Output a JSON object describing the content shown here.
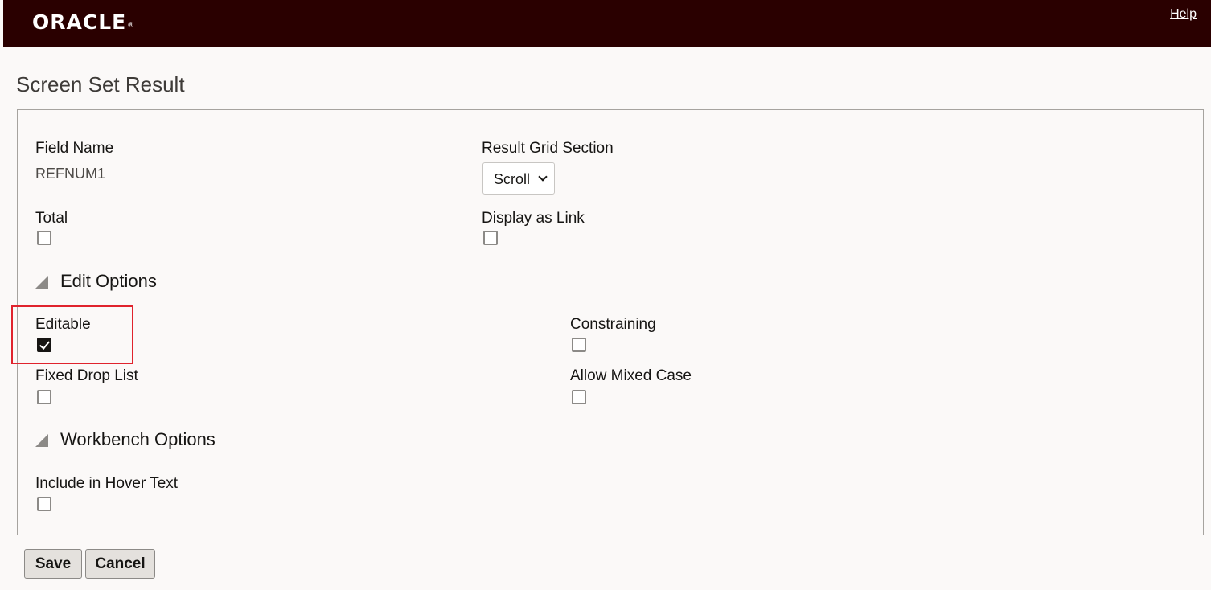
{
  "header": {
    "logo_text": "ORACLE",
    "logo_mark": "®",
    "help_label": "Help"
  },
  "page": {
    "title": "Screen Set Result"
  },
  "form": {
    "field_name_label": "Field Name",
    "field_name_value": "REFNUM1",
    "result_grid_section_label": "Result Grid Section",
    "result_grid_section_value": "Scroll",
    "total_label": "Total",
    "total_checked": false,
    "display_as_link_label": "Display as Link",
    "display_as_link_checked": false
  },
  "edit_options": {
    "header": "Edit Options",
    "editable_label": "Editable",
    "editable_checked": true,
    "constraining_label": "Constraining",
    "constraining_checked": false,
    "fixed_drop_list_label": "Fixed Drop List",
    "fixed_drop_list_checked": false,
    "allow_mixed_case_label": "Allow Mixed Case",
    "allow_mixed_case_checked": false
  },
  "workbench_options": {
    "header": "Workbench Options",
    "include_hover_text_label": "Include in Hover Text",
    "include_hover_text_checked": false
  },
  "actions": {
    "save_label": "Save",
    "cancel_label": "Cancel"
  },
  "colors": {
    "header_bg": "#2a0000",
    "highlight": "#e0232d"
  },
  "icons": {
    "section_toggle": "triangle-expanded-icon",
    "select_arrow": "chevron-down-icon",
    "checkmark": "checkmark-icon"
  }
}
